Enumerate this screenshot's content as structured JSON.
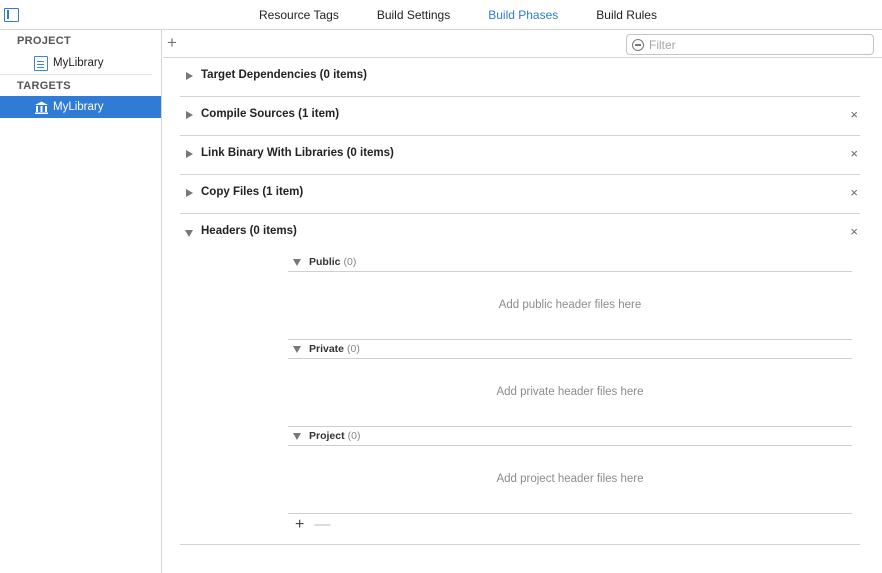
{
  "tabs": [
    {
      "label": "Resource Tags"
    },
    {
      "label": "Build Settings"
    },
    {
      "label": "Build Phases"
    },
    {
      "label": "Build Rules"
    }
  ],
  "sidebar": {
    "project_header": "PROJECT",
    "project_item": "MyLibrary",
    "targets_header": "TARGETS",
    "target_item": "MyLibrary"
  },
  "toolbar": {
    "add_symbol": "+",
    "filter_placeholder": "Filter"
  },
  "phases": [
    {
      "title": "Target Dependencies (0 items)"
    },
    {
      "title": "Compile Sources (1 item)"
    },
    {
      "title": "Link Binary With Libraries (0 items)"
    },
    {
      "title": "Copy Files (1 item)"
    },
    {
      "title": "Headers (0 items)"
    }
  ],
  "close_symbol": "×",
  "headers": {
    "sections": [
      {
        "name": "Public",
        "count": "(0)",
        "hint": "Add public header files here"
      },
      {
        "name": "Private",
        "count": "(0)",
        "hint": "Add private header files here"
      },
      {
        "name": "Project",
        "count": "(0)",
        "hint": "Add project header files here"
      }
    ],
    "add_symbol": "+",
    "remove_symbol": "—"
  },
  "colors": {
    "accent": "#2f7bd6",
    "selected_bg": "#2f7bd6"
  }
}
